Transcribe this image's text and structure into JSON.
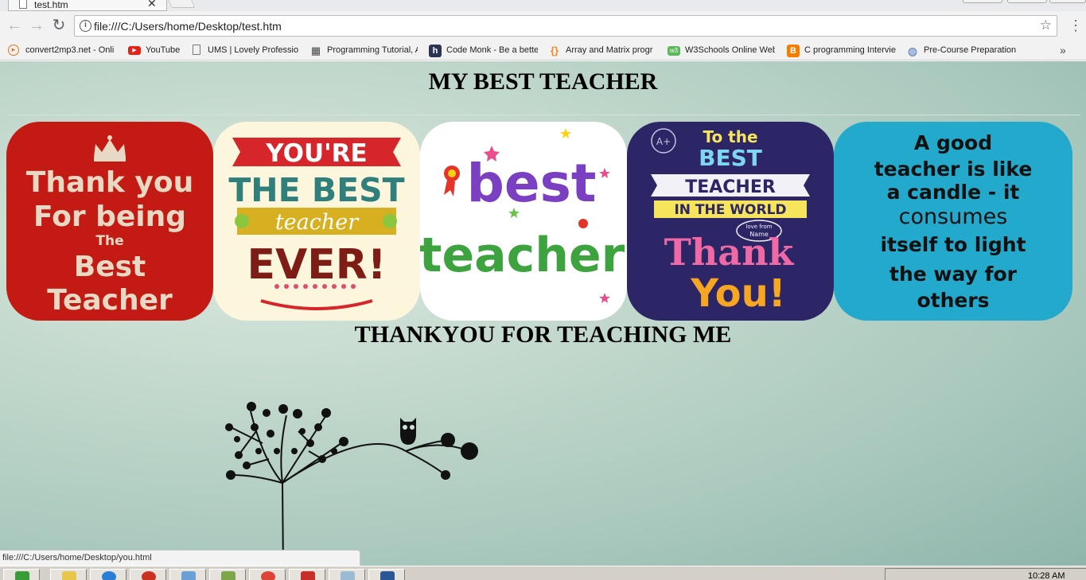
{
  "browser": {
    "tab": {
      "title": "test.htm"
    },
    "address_bar": {
      "url": "file:///C:/Users/home/Desktop/test.htm"
    },
    "bookmarks": [
      {
        "label": "convert2mp3.net - Onli",
        "icon": "convert2mp3-icon",
        "color": "#e8731a"
      },
      {
        "label": "YouTube",
        "icon": "youtube-icon",
        "color": "#e62117"
      },
      {
        "label": "UMS | Lovely Professior",
        "icon": "document-icon",
        "color": "#777777"
      },
      {
        "label": "Programming Tutorial, A",
        "icon": "gift-icon",
        "color": "#444444"
      },
      {
        "label": "Code Monk - Be a bette",
        "icon": "hackerearth-icon",
        "color": "#2c3454"
      },
      {
        "label": "Array and Matrix progr",
        "icon": "braces-icon",
        "color": "#f08a24"
      },
      {
        "label": "W3Schools Online Web",
        "icon": "w3schools-icon",
        "color": "#5cb85c"
      },
      {
        "label": "C programming Intervie",
        "icon": "blogger-icon",
        "color": "#f57d00"
      },
      {
        "label": "Pre-Course Preparation",
        "icon": "globe-icon",
        "color": "#3d6bb3"
      }
    ],
    "status_text": "file:///C:/Users/home/Desktop/you.html"
  },
  "page": {
    "title": "MY BEST TEACHER",
    "thanks_heading": "THANKYOU FOR TEACHING ME",
    "tiles": [
      {
        "lines": [
          "Thank you",
          "For being",
          "The",
          "Best",
          "Teacher"
        ]
      },
      {
        "lines": [
          "YOU'RE",
          "THE BEST",
          "teacher",
          "EVER!"
        ]
      },
      {
        "lines": [
          "best",
          "teacher"
        ]
      },
      {
        "lines": [
          "A+",
          "To the",
          "BEST",
          "TEACHER",
          "IN THE WORLD",
          "love from",
          "Name",
          "Thank",
          "You!"
        ]
      },
      {
        "lines": [
          "A good",
          "teacher is like",
          "a candle - it",
          "consumes",
          "itself to light",
          "the way for",
          "others"
        ]
      }
    ]
  },
  "taskbar": {
    "clock": "10:28 AM"
  },
  "colors": {
    "page_bg": "#b9d3c9",
    "tile1": "#c41a14",
    "tile4": "#2c2566",
    "tile5": "#22a9cc"
  }
}
